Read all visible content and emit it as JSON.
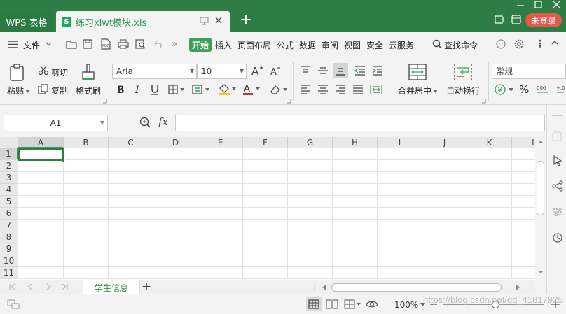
{
  "titlebar": {
    "app_tab": "WPS 表格",
    "doc_tab": "练习xlwt模块.xls",
    "doc_icon": "S",
    "new_tab": "+",
    "login": "未登录"
  },
  "menu": {
    "file": "文件",
    "start": "开始",
    "items": [
      "插入",
      "页面布局",
      "公式",
      "数据",
      "审阅",
      "视图",
      "安全",
      "云服务"
    ],
    "search": "查找命令"
  },
  "ribbon": {
    "paste": "粘贴",
    "cut": "剪切",
    "copy": "复制",
    "format_painter": "格式刷",
    "font_name": "Arial",
    "font_size": "10",
    "merge_center": "合并居中",
    "wrap_text": "自动换行",
    "number_format": "常规",
    "currency": "¥",
    "percent": "%"
  },
  "formula_bar": {
    "cell_ref": "A1",
    "fx": "fx",
    "value": ""
  },
  "grid": {
    "columns": [
      "A",
      "B",
      "C",
      "D",
      "E",
      "F",
      "G",
      "H",
      "I",
      "J",
      "K",
      "L"
    ],
    "rows": [
      "1",
      "2",
      "3",
      "4",
      "5",
      "6",
      "7",
      "8",
      "9",
      "10",
      "11"
    ],
    "active_cell": "A1"
  },
  "sheets": {
    "tabs": [
      "学生信息"
    ],
    "add": "+"
  },
  "status": {
    "zoom": "100%",
    "watermark": "https://blog.csdn.net/qq_41817925"
  },
  "colors": {
    "titlebar": "#2e7d46",
    "accent": "#3aa05a",
    "login": "#e4574b"
  }
}
